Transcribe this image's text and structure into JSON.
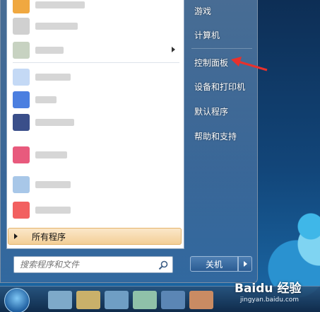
{
  "start_menu": {
    "left_pane": {
      "programs": [
        {
          "icon": "app-icon",
          "color": "#f0a840"
        },
        {
          "icon": "app-icon",
          "color": "#c9c9c9"
        },
        {
          "icon": "app-icon",
          "color": "#c7d2c1"
        },
        {
          "icon": "app-icon",
          "color": "#c4d9f5"
        },
        {
          "icon": "app-icon",
          "color": "#4b7fe0"
        },
        {
          "icon": "app-icon",
          "color": "#3a4f8a"
        },
        {
          "icon": "app-icon",
          "color": "#e85a7d"
        },
        {
          "icon": "app-icon",
          "color": "#a8c7e8"
        },
        {
          "icon": "app-icon",
          "color": "#f26060"
        }
      ],
      "all_programs_label": "所有程序",
      "search_placeholder": "搜索程序和文件"
    },
    "right_pane": {
      "items": [
        {
          "label": "游戏"
        },
        {
          "label": "计算机"
        },
        {
          "label": "控制面板"
        },
        {
          "label": "设备和打印机"
        },
        {
          "label": "默认程序"
        },
        {
          "label": "帮助和支持"
        }
      ],
      "shutdown_label": "关机"
    }
  },
  "annotation": {
    "color": "#e8312c"
  },
  "watermark": {
    "main": "Baidu 经验",
    "sub": "jingyan.baidu.com"
  }
}
